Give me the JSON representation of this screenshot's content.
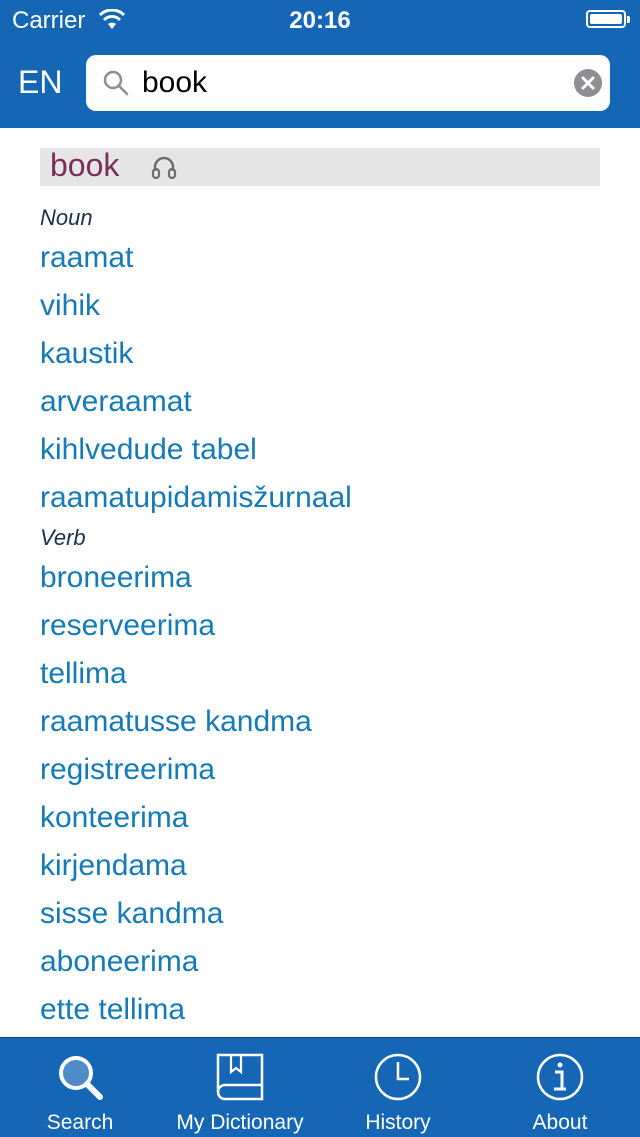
{
  "status_bar": {
    "carrier": "Carrier",
    "time": "20:16"
  },
  "header": {
    "language": "EN",
    "search": {
      "value": "book",
      "placeholder": ""
    }
  },
  "entry": {
    "headword": "book",
    "sections": [
      {
        "pos": "Noun",
        "translations": [
          "raamat",
          "vihik",
          "kaustik",
          "arveraamat",
          "kihlvedude tabel",
          "raamatupidamisžurnaal"
        ]
      },
      {
        "pos": "Verb",
        "translations": [
          "broneerima",
          "reserveerima",
          "tellima",
          "raamatusse kandma",
          "registreerima",
          "konteerima",
          "kirjendama",
          "sisse kandma",
          "aboneerima",
          "ette tellima"
        ]
      }
    ]
  },
  "tabs": [
    {
      "label": "Search",
      "icon": "search-icon"
    },
    {
      "label": "My Dictionary",
      "icon": "book-icon"
    },
    {
      "label": "History",
      "icon": "clock-icon"
    },
    {
      "label": "About",
      "icon": "info-icon"
    }
  ],
  "colors": {
    "brand_blue": "#1566b5",
    "link_blue": "#147ab8",
    "headword": "#7a2f5a"
  }
}
